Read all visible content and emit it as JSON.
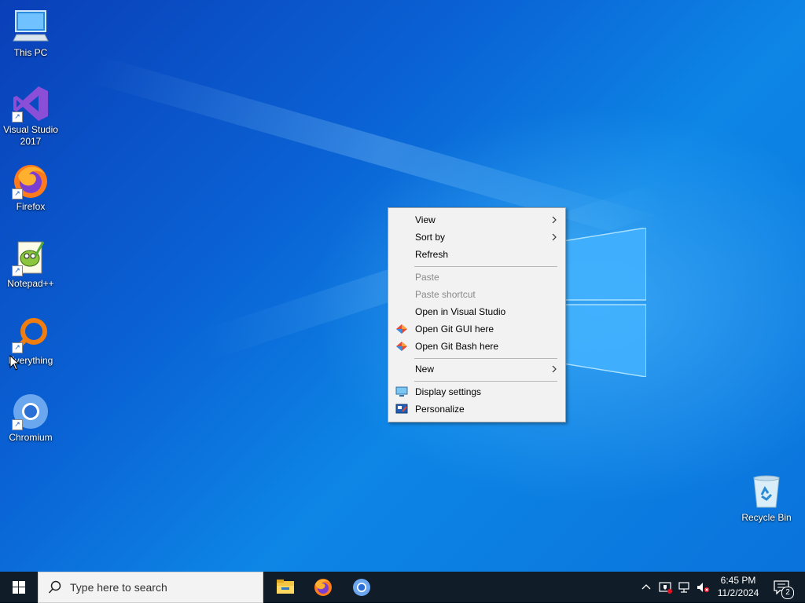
{
  "desktop": {
    "icons": [
      {
        "label": "This PC"
      },
      {
        "label": "Visual Studio\n2017"
      },
      {
        "label": "Firefox"
      },
      {
        "label": "Notepad++"
      },
      {
        "label": "Everything"
      },
      {
        "label": "Chromium"
      },
      {
        "label": "Recycle Bin"
      }
    ]
  },
  "context_menu": {
    "items": [
      {
        "label": "View",
        "submenu": true
      },
      {
        "label": "Sort by",
        "submenu": true
      },
      {
        "label": "Refresh"
      },
      {
        "label": "Paste",
        "disabled": true
      },
      {
        "label": "Paste shortcut",
        "disabled": true
      },
      {
        "label": "Open in Visual Studio"
      },
      {
        "label": "Open Git GUI here",
        "icon": "git-icon"
      },
      {
        "label": "Open Git Bash here",
        "icon": "git-icon"
      },
      {
        "label": "New",
        "submenu": true
      },
      {
        "label": "Display settings",
        "icon": "display-icon"
      },
      {
        "label": "Personalize",
        "icon": "personalize-icon"
      }
    ]
  },
  "taskbar": {
    "search_placeholder": "Type here to search",
    "pinned": [
      "file-explorer-icon",
      "firefox-icon",
      "chromium-icon"
    ],
    "clock_time": "6:45 PM",
    "clock_date": "11/2/2024",
    "notification_count": "2"
  },
  "colors": {
    "desktop_blue": "#0a62d4",
    "taskbar": "#101c28",
    "menu_bg": "#f2f2f2"
  }
}
